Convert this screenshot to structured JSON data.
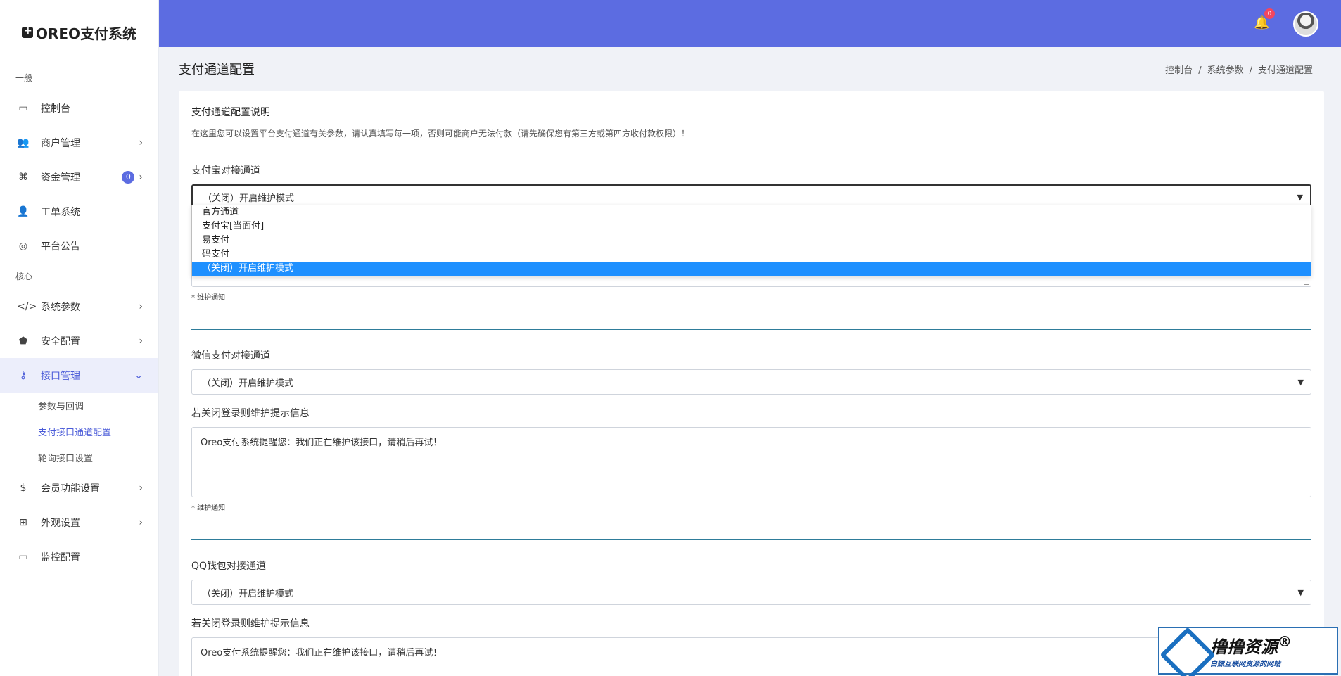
{
  "brand": {
    "title": "OREO支付系统"
  },
  "sidebar": {
    "section_general": "一般",
    "section_core": "核心",
    "items": [
      {
        "label": "控制台",
        "icon": "monitor-icon"
      },
      {
        "label": "商户管理",
        "icon": "users-icon"
      },
      {
        "label": "资金管理",
        "icon": "command-icon",
        "badge": "0"
      },
      {
        "label": "工单系统",
        "icon": "user-gear-icon"
      },
      {
        "label": "平台公告",
        "icon": "broadcast-icon"
      },
      {
        "label": "系统参数",
        "icon": "code-icon"
      },
      {
        "label": "安全配置",
        "icon": "shield-icon"
      },
      {
        "label": "接口管理",
        "icon": "key-icon"
      },
      {
        "label": "会员功能设置",
        "icon": "dollar-card-icon"
      },
      {
        "label": "外观设置",
        "icon": "add-square-icon"
      },
      {
        "label": "监控配置",
        "icon": "monitor-icon"
      }
    ],
    "sub_items": [
      "参数与回调",
      "支付接口通道配置",
      "轮询接口设置"
    ]
  },
  "header": {
    "notification_count": "0"
  },
  "page": {
    "title": "支付通道配置",
    "breadcrumb": [
      "控制台",
      "系统参数",
      "支付通道配置"
    ]
  },
  "card": {
    "heading": "支付通道配置说明",
    "description": "在这里您可以设置平台支付通道有关参数，请认真填写每一项，否则可能商户无法付款（请先确保您有第三方或第四方收付款权限）！",
    "alipay": {
      "label": "支付宝对接通道",
      "selected": "（关闭）开启维护模式",
      "options": [
        "官方通道",
        "支付宝[当面付]",
        "易支付",
        "码支付",
        "（关闭）开启维护模式"
      ],
      "hint": "* 维护通知"
    },
    "wechat": {
      "label": "微信支付对接通道",
      "selected": "（关闭）开启维护模式",
      "msg_label": "若关闭登录则维护提示信息",
      "msg_value": "Oreo支付系统提醒您：我们正在维护该接口，请稍后再试！",
      "hint": "* 维护通知"
    },
    "qq": {
      "label": "QQ钱包对接通道",
      "selected": "（关闭）开启维护模式",
      "msg_label": "若关闭登录则维护提示信息",
      "msg_value": "Oreo支付系统提醒您：我们正在维护该接口，请稍后再试！"
    }
  },
  "watermark": {
    "title": "撸撸资源",
    "subtitle": "白嫖互联网资源的网站",
    "reg": "®"
  }
}
